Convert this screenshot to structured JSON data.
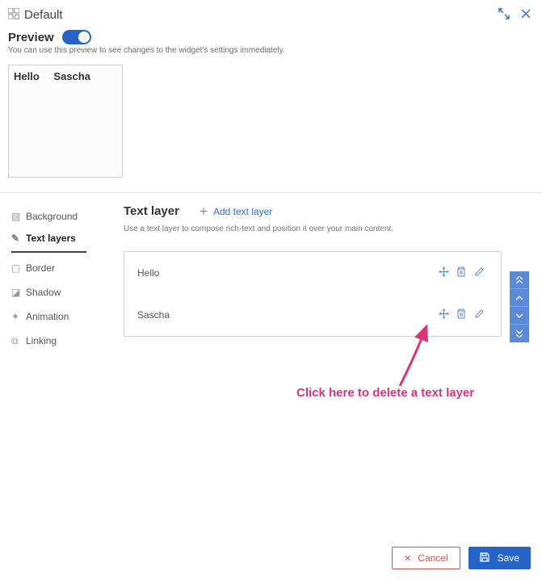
{
  "header": {
    "title": "Default"
  },
  "preview": {
    "label": "Preview",
    "hint": "You can use this preview to see changes to the widget's settings immediately.",
    "text1": "Hello",
    "text2": "Sascha"
  },
  "sidenav": {
    "items": [
      {
        "label": "Background"
      },
      {
        "label": "Text layers"
      },
      {
        "label": "Border"
      },
      {
        "label": "Shadow"
      },
      {
        "label": "Animation"
      },
      {
        "label": "Linking"
      }
    ],
    "active_index": 1
  },
  "section": {
    "title": "Text layer",
    "add_label": "Add text layer",
    "description": "Use a text layer to compose rich-text and position it over your main content."
  },
  "layers": {
    "items": [
      {
        "name": "Hello"
      },
      {
        "name": "Sascha"
      }
    ]
  },
  "annotation": {
    "text": "Click here to delete a text layer"
  },
  "footer": {
    "cancel": "Cancel",
    "save": "Save"
  }
}
